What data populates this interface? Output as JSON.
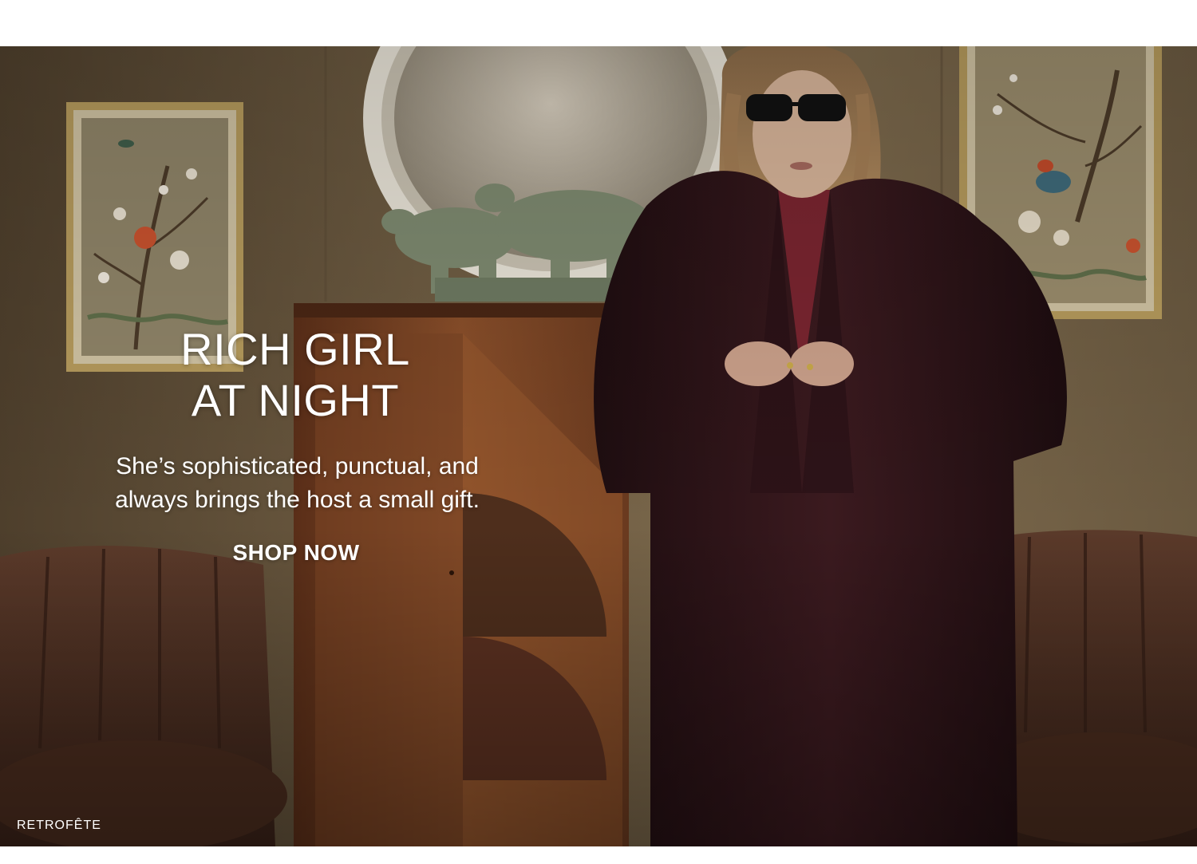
{
  "hero": {
    "headline_lines": [
      "RICH GIRL",
      "AT NIGHT"
    ],
    "subhead_lines": [
      "She’s sophisticated, punctual, and",
      "always brings the host a small gift."
    ],
    "cta_label": "SHOP NOW",
    "brand_label": "RETROFÊTE",
    "image_alt": "Model in sunglasses wearing a long dark burgundy faux fur coat in a vintage room with framed bird paintings, a round white mirror, a polar bear sculpture, a wooden cabinet and velvet armchairs"
  },
  "colors": {
    "text": "#ffffff",
    "page_background": "#ffffff",
    "wall": "#6b5a40",
    "coat": "#2a1518",
    "turtleneck": "#7a2530"
  }
}
